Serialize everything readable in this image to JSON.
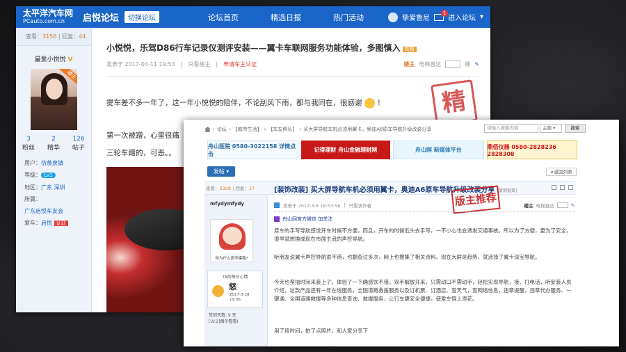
{
  "left": {
    "topbar": {
      "logo": "太平洋汽车网",
      "logo_sub": "PCauto.com.cn",
      "forum_name": "启悦论坛",
      "switch_label": "切换论坛",
      "nav": [
        "论坛首页",
        "精选日报",
        "热门活动"
      ],
      "username": "挚爱鲁尼",
      "mail_count": "1",
      "enter_forum": "进入论坛"
    },
    "sidebar": {
      "views_label": "查看：",
      "views": "3156",
      "replies_label": "回复：",
      "replies": "44",
      "user_name": "最爱小悦悦",
      "user_mark": "V",
      "avatar_tag": "楼主",
      "counts": [
        {
          "n": "3",
          "label": "粉丝"
        },
        {
          "n": "2",
          "label": "精华"
        },
        {
          "n": "126",
          "label": "帖子"
        }
      ],
      "info": [
        {
          "k": "用户：",
          "v": "仿羡泉镇"
        },
        {
          "k": "等级：",
          "v": "Lv1"
        },
        {
          "k": "地区：",
          "v": "广东 深圳"
        },
        {
          "k": "所属：",
          "v": ""
        },
        {
          "k": "",
          "v": "广东启悦车友会"
        },
        {
          "k": "爱车：",
          "v": "启悦"
        }
      ],
      "auth_badge": "认证"
    },
    "post": {
      "title": "小悦悦，乐驾D86行车记录仪测评安装——翼卡车联网服务功能体验，多图慎入",
      "pic_tag": "有图",
      "posted_at": "发表于 2017-04-11 19:53",
      "only_owner": "只看楼主",
      "cert": "申请车主认证",
      "owner": "楼主",
      "jump_label": "电梯直达",
      "floor_unit": "楼",
      "line1": "提车差不多一年了，这一年小悦悦的陪伴，不论刮风下雨，都与我同在，很感谢",
      "line1_end": "！",
      "line2": "第一次被蹭，心里很痛",
      "line3": "三轮车蹭的，可恶。。",
      "stamp": "精"
    }
  },
  "right": {
    "crumbs": [
      "论坛",
      "【城市生活】",
      "【车友俱乐】",
      "买大屏导航车机必须用翼卡，奥迪A6原车导航升级改装分享"
    ],
    "search_placeholder": "请输入搜索内容",
    "search_scope": "主题",
    "search_btn": "搜索",
    "ads": [
      "舟山医院 0580-3022158 详情点击",
      "记得理财 舟山金融理财网",
      "舟山网 新媒体平台",
      "鼎佰仪器 0580-2828236 2828308"
    ],
    "post_btn": "发帖",
    "back_list": "返回列表",
    "stats": {
      "views_label": "查看：",
      "views": "2328",
      "replies_label": "回复：",
      "replies": "37"
    },
    "title": "[装饰改装] 买大屏导航车机必须用翼卡，奥迪A6原车导航升级改装分享",
    "title_tag": "[复制链接]",
    "user_name": "mfydymfydy",
    "avatar_caption": "你为什么还不摸我?",
    "mood_title": "TA的每日心情",
    "mood_word": "怒",
    "mood_date": "2017-3-28",
    "mood_time": "19:36",
    "sign_days": "签到天数: 9 天",
    "level": "[LV.2]偶尔看看I",
    "meta": {
      "posted": "发表于 2017-3-6 18:53:56",
      "only_owner": "只看该作者",
      "owner": "楼主",
      "jump_label": "电梯直达"
    },
    "stamp": "版主推荐",
    "wx": "舟山网官方微信 加关注",
    "p1": "原车的手写导航感觉开车时候不方便，而且，开车的时候低头去手写，一不小心也会诱发交通事故。所以为了方便，更为了安全，很早就想换成现在市面主流的声控导航。",
    "p2": "听朋友说翼卡声控导航很不错，也翻查过多次，网上也搜集了相关资料。现在大屏是趋势，就选择了翼卡深宝导航。",
    "p3": "今天也蛮抽时间来装上了。体验了一下确感饮不错，双手解放开来，只需动口不需动手，轻松实现导航，接、打电话，听安装人员介绍，这款产品还有一年在线服务，全国道路救援服务以及订机票、订酒店、查天气，查网络信息，违章提醒，违章代办服务、一键通、全国道路救援等多种信息查询、救援服务，让行车更安全便捷，使爱车锦上添花。",
    "p4": "用了段时间，拍了点照片，和人家分享下"
  }
}
